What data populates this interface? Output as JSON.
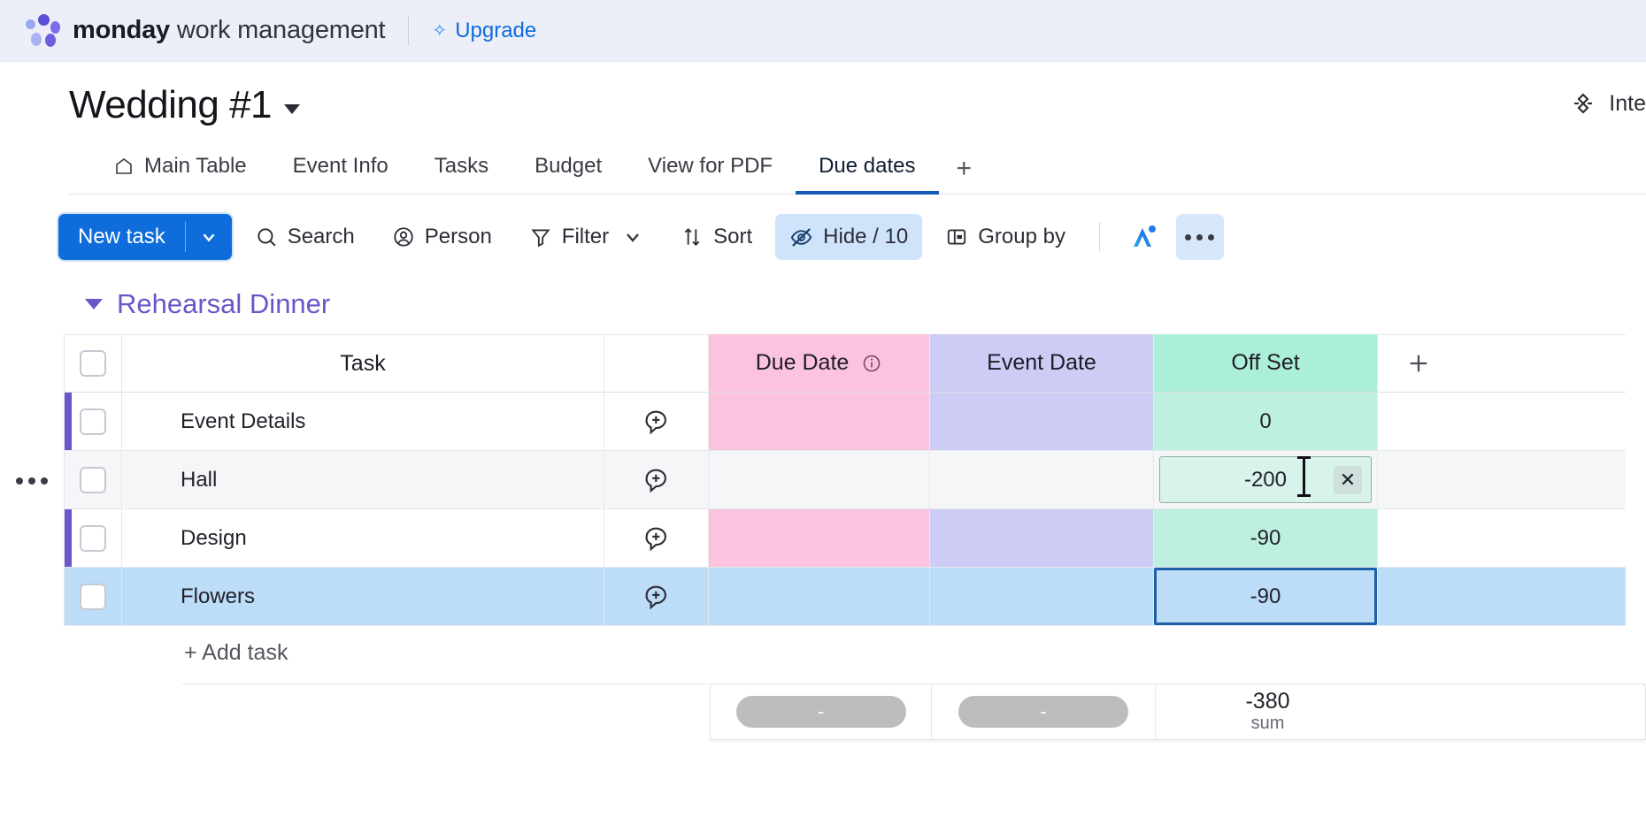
{
  "topbar": {
    "brand_bold": "monday",
    "brand_light": " work management",
    "upgrade_label": "Upgrade",
    "sparkle_icon": "sparkle-icon",
    "logo_icon": "monday-logo-icon"
  },
  "board": {
    "title": "Wedding #1",
    "title_caret_icon": "chevron-down-icon",
    "integrate_label": "Inte",
    "integrate_icon": "plug-icon"
  },
  "tabs": [
    {
      "label": "Main Table",
      "icon": "home-icon",
      "active": false
    },
    {
      "label": "Event Info",
      "icon": "",
      "active": false
    },
    {
      "label": "Tasks",
      "icon": "",
      "active": false
    },
    {
      "label": "Budget",
      "icon": "",
      "active": false
    },
    {
      "label": "View for PDF",
      "icon": "",
      "active": false
    },
    {
      "label": "Due dates",
      "icon": "",
      "active": true
    }
  ],
  "tabs_add_label": "+",
  "toolbar": {
    "new_task_label": "New task",
    "new_task_caret_icon": "chevron-down-icon",
    "search_label": "Search",
    "search_icon": "search-icon",
    "person_label": "Person",
    "person_icon": "person-icon",
    "filter_label": "Filter",
    "filter_icon": "funnel-icon",
    "filter_caret_icon": "chevron-down-icon",
    "sort_label": "Sort",
    "sort_icon": "sort-arrows-icon",
    "hide_label": "Hide / 10",
    "hide_icon": "eye-off-icon",
    "group_by_label": "Group by",
    "group_by_icon": "group-by-icon",
    "ai_icon": "ai-assistant-icon",
    "more_icon": "more-options-icon"
  },
  "group": {
    "name": "Rehearsal Dinner",
    "caret_icon": "chevron-down-icon",
    "accent_color": "#6a56c9",
    "row_menu_icon": "row-menu-icon"
  },
  "table": {
    "columns": [
      {
        "key": "task",
        "label": "Task",
        "color": "#ffffff"
      },
      {
        "key": "date",
        "label": "Due Date",
        "color": "#fbc3dd",
        "info_icon": "info-icon"
      },
      {
        "key": "event",
        "label": "Event Date",
        "color": "#ccccf5"
      },
      {
        "key": "off",
        "label": "Off Set",
        "color": "#acefd8"
      }
    ],
    "add_column_icon": "plus-icon",
    "rows": [
      {
        "task": "Event Details",
        "update_icon": "add-update-icon",
        "due_date": "",
        "event_date": "",
        "off_set": "0",
        "state": "normal"
      },
      {
        "task": "Hall",
        "update_icon": "add-update-icon",
        "due_date": "",
        "event_date": "",
        "off_set": "-200",
        "state": "hover",
        "editing": true,
        "clear_icon": "clear-x-icon"
      },
      {
        "task": "Design",
        "update_icon": "add-update-icon",
        "due_date": "",
        "event_date": "",
        "off_set": "-90",
        "state": "normal"
      },
      {
        "task": "Flowers",
        "update_icon": "add-update-icon",
        "due_date": "",
        "event_date": "",
        "off_set": "-90",
        "state": "selected",
        "cell_selected": true
      }
    ],
    "add_task_label": "+ Add task"
  },
  "summary": {
    "due_date_value": "-",
    "event_date_value": "-",
    "off_set_value": "-380",
    "off_set_function": "sum"
  }
}
